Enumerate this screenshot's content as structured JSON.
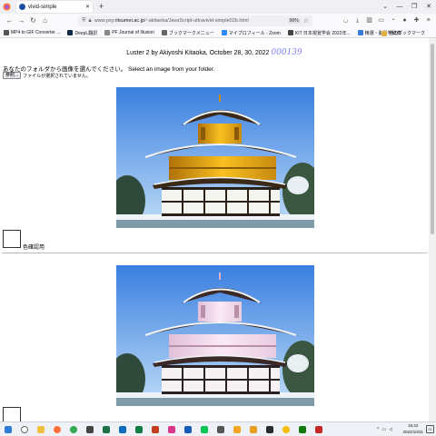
{
  "browser": {
    "tab_title": "vivid-simple",
    "url_prefix": "www.psy.",
    "url_domain": "ritsumei.ac.jp",
    "url_rest": "/~akitaoka/JavaScript-ultravivid-simple02b.html",
    "zoom": "90%",
    "bookmarks": [
      {
        "label": "MP4 to GIF Converter ...",
        "color": "#555555"
      },
      {
        "label": "DeepL翻訳",
        "color": "#0f2b46"
      },
      {
        "label": "PF Journal of Illusion",
        "color": "#888888"
      },
      {
        "label": "ブックマークメニュー",
        "color": "#666666"
      },
      {
        "label": "マイプロフィール - Zoom",
        "color": "#2d8cff"
      },
      {
        "label": "KIT 日本視覚学会 2022年...",
        "color": "#444444"
      },
      {
        "label": "精選・脳科学辞典",
        "color": "#3a7bd5"
      }
    ],
    "other_bookmarks": "他のブックマーク"
  },
  "page": {
    "header_text": "Luster 2 by Akiyoshi Kitaoka, October 28, 30, 2022",
    "counter": "000139",
    "prompt": "あなたのフォルダから画像を選んでください。 Select an image from your folder.",
    "file_button": "参照...",
    "file_status": "ファイルが選択されていません。",
    "color_label": "色確認用"
  },
  "taskbar": {
    "time": "15:22",
    "date": "2022/10/31",
    "notif": "21"
  }
}
